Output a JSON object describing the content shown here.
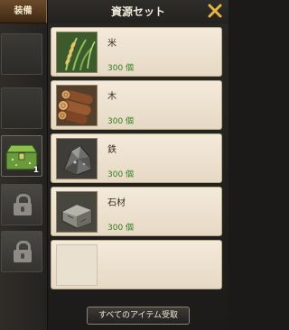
{
  "left_panel": {
    "tab_label": "装備",
    "slots": [
      {
        "state": "empty"
      },
      {
        "state": "empty"
      },
      {
        "state": "item",
        "icon": "green-chest-icon",
        "count": "1"
      },
      {
        "state": "locked",
        "icon": "lock-icon"
      },
      {
        "state": "locked",
        "icon": "lock-icon"
      }
    ]
  },
  "dialog": {
    "title": "資源セット",
    "close_icon": "close-x-icon",
    "items": [
      {
        "name": "米",
        "quantity": "300 個",
        "icon": "rice-icon"
      },
      {
        "name": "木",
        "quantity": "300 個",
        "icon": "wood-logs-icon"
      },
      {
        "name": "鉄",
        "quantity": "300 個",
        "icon": "iron-ore-icon"
      },
      {
        "name": "石材",
        "quantity": "300 個",
        "icon": "stone-block-icon"
      }
    ],
    "receive_all_button": "すべてのアイテム受取"
  },
  "colors": {
    "accent_gold": "#e8b441",
    "quantity_green": "#2f7f1e",
    "row_background": "#f1e7d6"
  }
}
